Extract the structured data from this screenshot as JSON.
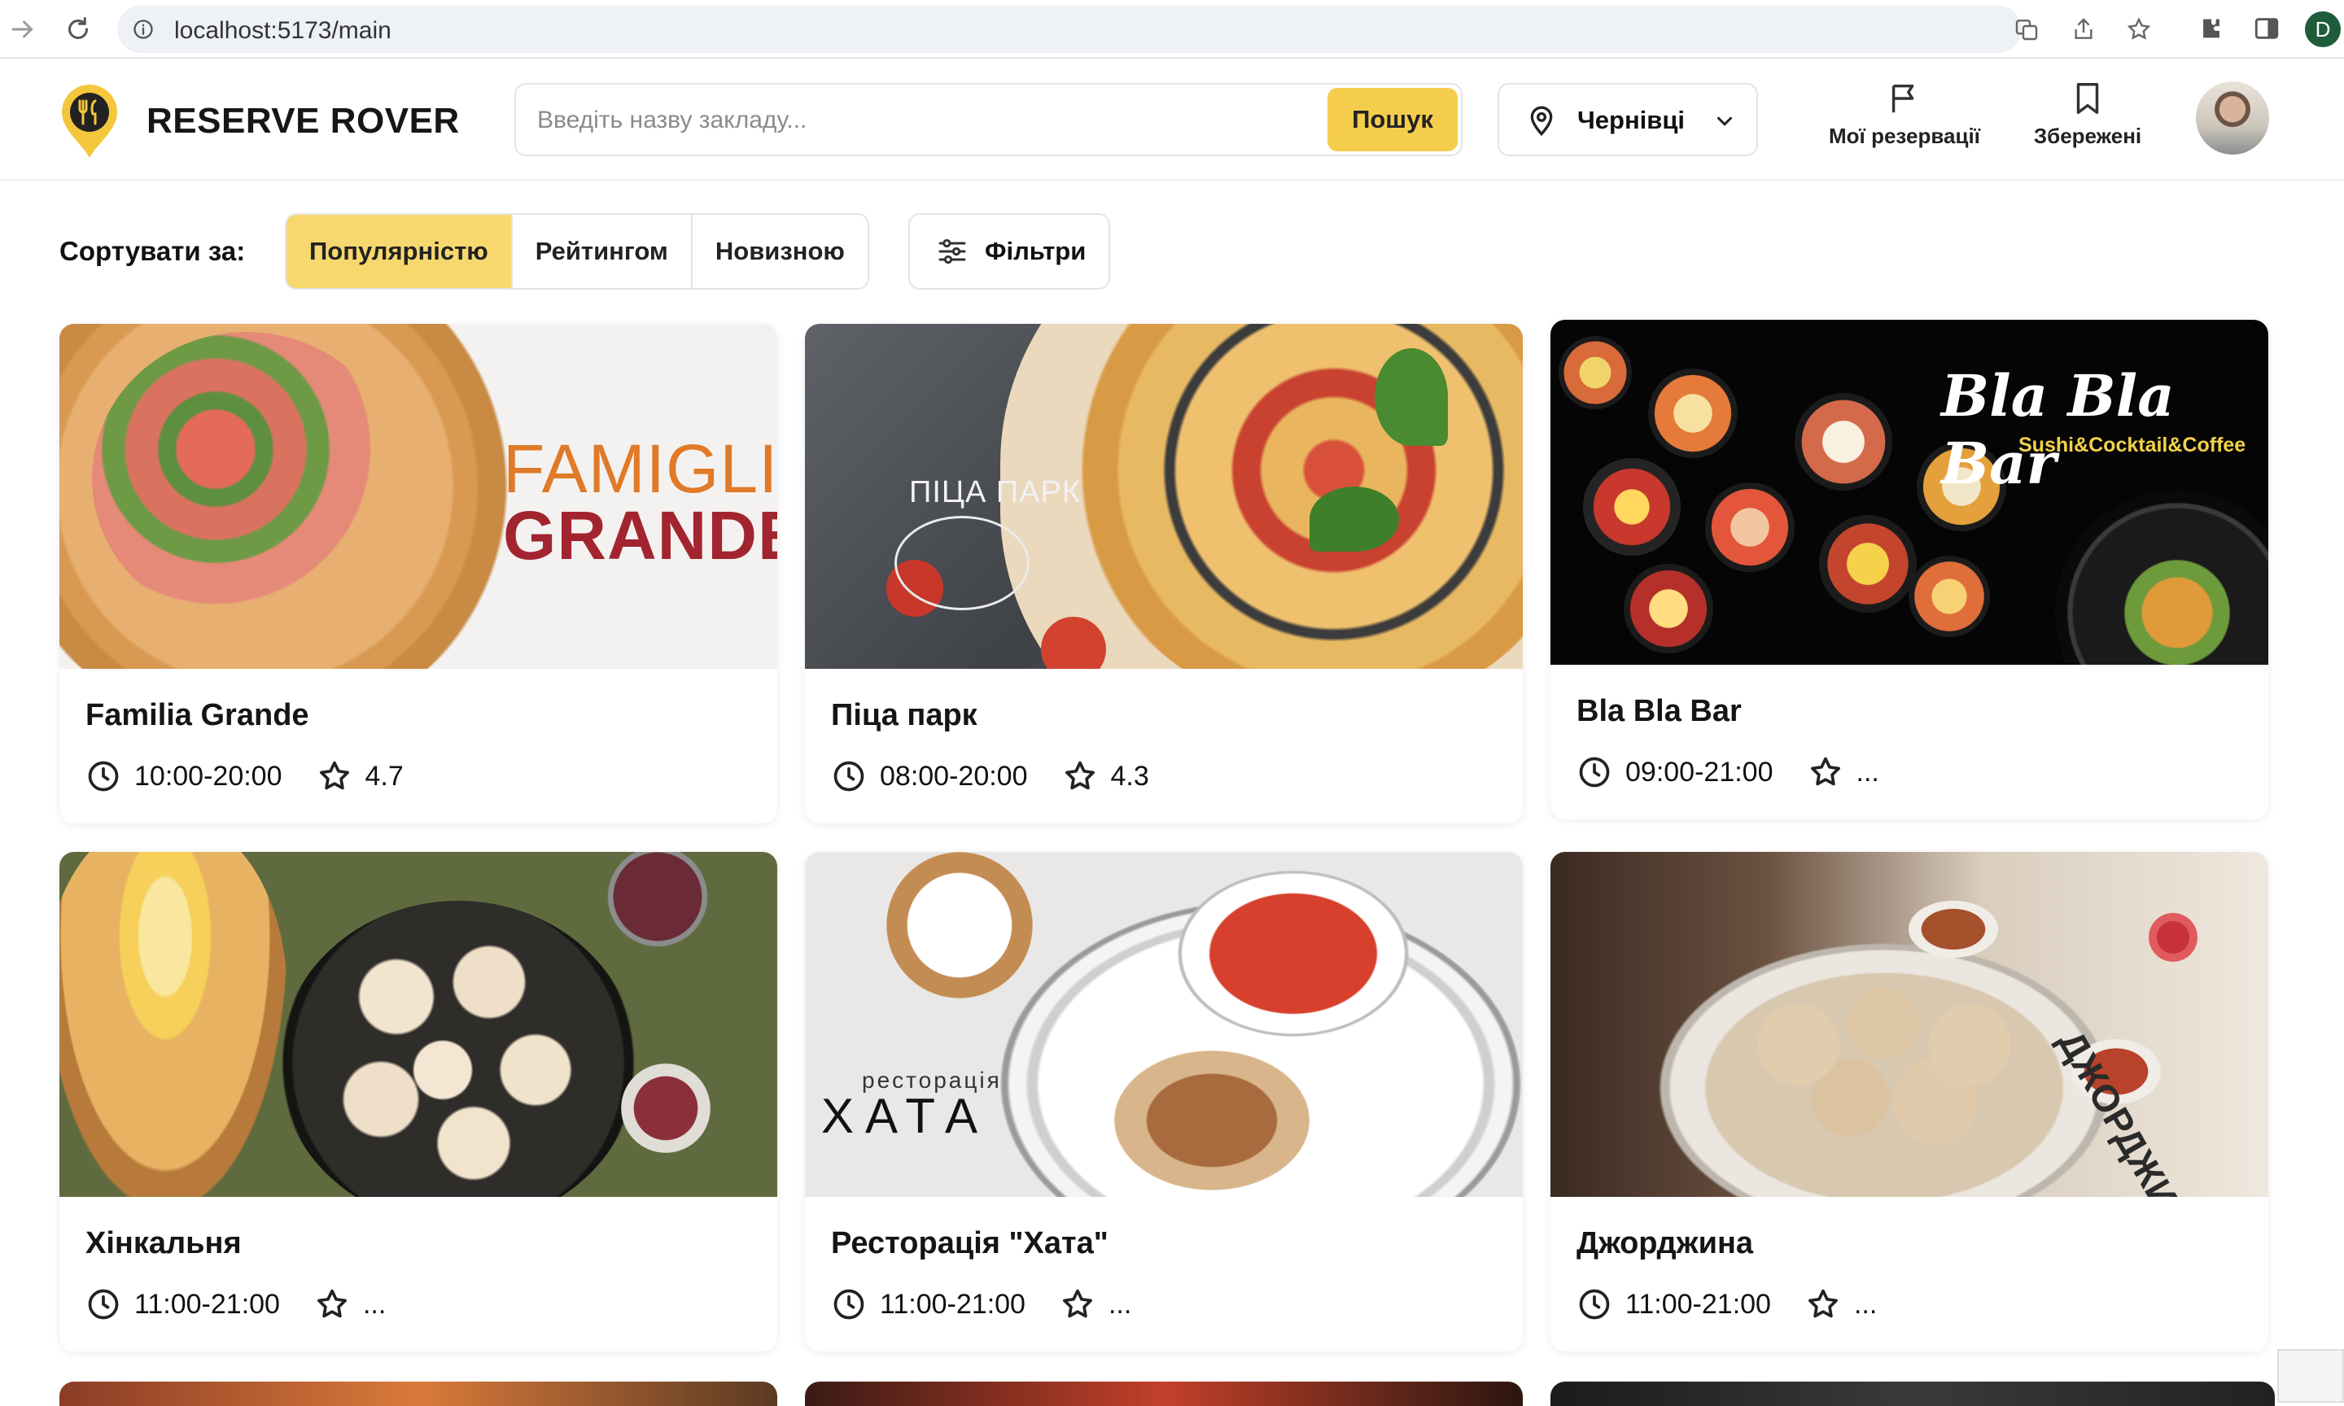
{
  "browser": {
    "url": "localhost:5173/main",
    "profile_initial": "D"
  },
  "header": {
    "brand": "RESERVE ROVER",
    "search_placeholder": "Введіть назву закладу...",
    "search_button": "Пошук",
    "city": "Чернівці",
    "reservations_label": "Мої резервації",
    "saved_label": "Збережені"
  },
  "sort": {
    "label": "Сортувати за:",
    "options": [
      "Популярністю",
      "Рейтингом",
      "Новизною"
    ],
    "active": "Популярністю",
    "filters_label": "Фільтри"
  },
  "restaurants": [
    {
      "name": "Familia Grande",
      "hours": "10:00-20:00",
      "rating": "4.7",
      "image_text_1": "FAMIGLIA",
      "image_text_2": "GRANDE"
    },
    {
      "name": "Піца парк",
      "hours": "08:00-20:00",
      "rating": "4.3",
      "image_text_1": "ПІЦА ПАРК"
    },
    {
      "name": "Bla Bla Bar",
      "hours": "09:00-21:00",
      "rating": "...",
      "image_text_1": "Bla Bla Bar",
      "image_text_2": "Sushi&Cocktail&Coffee"
    },
    {
      "name": "Хінкальня",
      "hours": "11:00-21:00",
      "rating": "..."
    },
    {
      "name": "Ресторація \"Хата\"",
      "hours": "11:00-21:00",
      "rating": "...",
      "image_text_1": "ресторація",
      "image_text_2": "ХАТА"
    },
    {
      "name": "Джорджина",
      "hours": "11:00-21:00",
      "rating": "...",
      "image_text_1": "ДЖОРДЖИНА"
    }
  ],
  "colors": {
    "accent": "#f4cd4c",
    "accent_active": "#f7d86e",
    "text": "#151515",
    "border": "#e4e4e4"
  }
}
